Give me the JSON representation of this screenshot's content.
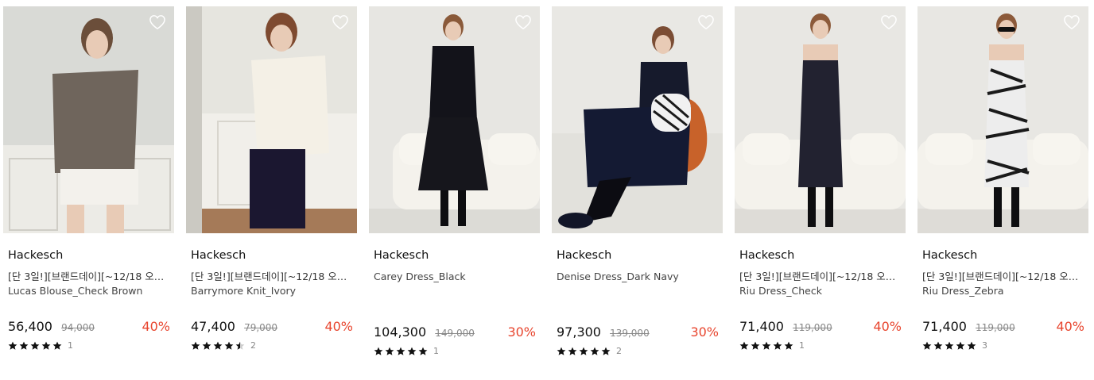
{
  "products": [
    {
      "brand": "Hackesch",
      "promo": "[단 3일!][브랜드데이][~12/18 오전...",
      "name": "Lucas Blouse_Check Brown",
      "price": "56,400",
      "original_price": "94,000",
      "discount": "40%",
      "rating": 5,
      "review_count": "1"
    },
    {
      "brand": "Hackesch",
      "promo": "[단 3일!][브랜드데이][~12/18 오전...",
      "name": "Barrymore Knit_Ivory",
      "price": "47,400",
      "original_price": "79,000",
      "discount": "40%",
      "rating": 4.5,
      "review_count": "2"
    },
    {
      "brand": "Hackesch",
      "promo": "",
      "name": "Carey Dress_Black",
      "price": "104,300",
      "original_price": "149,000",
      "discount": "30%",
      "rating": 5,
      "review_count": "1"
    },
    {
      "brand": "Hackesch",
      "promo": "",
      "name": "Denise Dress_Dark Navy",
      "price": "97,300",
      "original_price": "139,000",
      "discount": "30%",
      "rating": 5,
      "review_count": "2"
    },
    {
      "brand": "Hackesch",
      "promo": "[단 3일!][브랜드데이][~12/18 오전...",
      "name": "Riu Dress_Check",
      "price": "71,400",
      "original_price": "119,000",
      "discount": "40%",
      "rating": 5,
      "review_count": "1"
    },
    {
      "brand": "Hackesch",
      "promo": "[단 3일!][브랜드데이][~12/18 오전...",
      "name": "Riu Dress_Zebra",
      "price": "71,400",
      "original_price": "119,000",
      "discount": "40%",
      "rating": 5,
      "review_count": "3"
    }
  ],
  "colors": {
    "discount": "#e8452e",
    "star": "#111111",
    "star_empty": "#cccccc"
  },
  "icons": {
    "wishlist": "heart-outline-icon",
    "rating": "star-icon"
  }
}
